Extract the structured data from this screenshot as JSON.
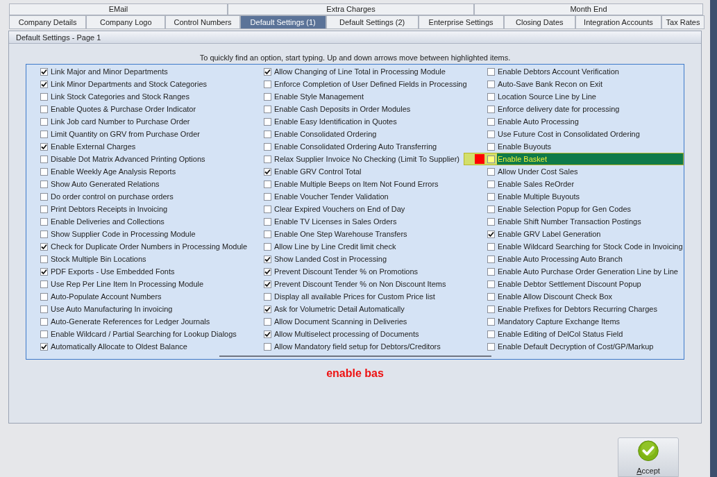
{
  "tabs_top": [
    {
      "label": "EMail",
      "selected": false
    },
    {
      "label": "Extra Charges",
      "selected": false
    },
    {
      "label": "Month End",
      "selected": false
    }
  ],
  "tabs": [
    {
      "label": "Company Details",
      "selected": false
    },
    {
      "label": "Company Logo",
      "selected": false
    },
    {
      "label": "Control Numbers",
      "selected": false
    },
    {
      "label": "Default Settings (1)",
      "selected": true
    },
    {
      "label": "Default Settings (2)",
      "selected": false
    },
    {
      "label": "Enterprise Settings",
      "selected": false
    },
    {
      "label": "Closing Dates",
      "selected": false
    },
    {
      "label": "Integration Accounts",
      "selected": false
    },
    {
      "label": "Tax Rates",
      "selected": false
    }
  ],
  "panel_title": "Default Settings - Page 1",
  "hint": "To quickly find an option, start typing. Up and down arrows move between highlighted items.",
  "columns": [
    [
      {
        "label": "Link Major and Minor Departments",
        "checked": true,
        "highlighted": false
      },
      {
        "label": "Link Minor Departments and Stock Categories",
        "checked": true,
        "highlighted": false
      },
      {
        "label": "Link Stock Categories and Stock Ranges",
        "checked": false,
        "highlighted": false
      },
      {
        "label": "Enable Quotes & Purchase Order Indicator",
        "checked": false,
        "highlighted": false
      },
      {
        "label": "Link Job card Number to Purchase Order",
        "checked": false,
        "highlighted": false
      },
      {
        "label": "Limit Quantity on GRV from Purchase Order",
        "checked": false,
        "highlighted": false
      },
      {
        "label": "Enable External Charges",
        "checked": true,
        "highlighted": false
      },
      {
        "label": "Disable Dot Matrix Advanced Printing Options",
        "checked": false,
        "highlighted": false
      },
      {
        "label": "Enable Weekly Age Analysis Reports",
        "checked": false,
        "highlighted": false
      },
      {
        "label": "Show Auto Generated Relations",
        "checked": false,
        "highlighted": false
      },
      {
        "label": "Do order control on purchase orders",
        "checked": false,
        "highlighted": false
      },
      {
        "label": "Print Debtors Receipts in Invoicing",
        "checked": false,
        "highlighted": false
      },
      {
        "label": "Enable Deliveries and Collections",
        "checked": false,
        "highlighted": false
      },
      {
        "label": "Show Supplier Code in Processing Module",
        "checked": false,
        "highlighted": false
      },
      {
        "label": "Check for Duplicate Order Numbers in Processing Module",
        "checked": true,
        "highlighted": false
      },
      {
        "label": "Stock Multiple Bin Locations",
        "checked": false,
        "highlighted": false
      },
      {
        "label": "PDF Exports - Use Embedded Fonts",
        "checked": true,
        "highlighted": false
      },
      {
        "label": "Use Rep Per Line Item In Processing Module",
        "checked": false,
        "highlighted": false
      },
      {
        "label": "Auto-Populate Account Numbers",
        "checked": false,
        "highlighted": false
      },
      {
        "label": "Use Auto Manufacturing In invoicing",
        "checked": false,
        "highlighted": false
      },
      {
        "label": "Auto-Generate References for Ledger Journals",
        "checked": false,
        "highlighted": false
      },
      {
        "label": "Enable Wildcard / Partial Searching for Lookup Dialogs",
        "checked": false,
        "highlighted": false
      },
      {
        "label": "Automatically Allocate to Oldest Balance",
        "checked": true,
        "highlighted": false
      }
    ],
    [
      {
        "label": "Allow Changing of Line Total in Processing Module",
        "checked": true,
        "highlighted": false
      },
      {
        "label": "Enforce Completion of User Defined Fields in Processing",
        "checked": false,
        "highlighted": false
      },
      {
        "label": "Enable Style Management",
        "checked": false,
        "highlighted": false
      },
      {
        "label": "Enable Cash Deposits in Order Modules",
        "checked": false,
        "highlighted": false
      },
      {
        "label": "Enable Easy Identification in Quotes",
        "checked": false,
        "highlighted": false
      },
      {
        "label": "Enable Consolidated Ordering",
        "checked": false,
        "highlighted": false
      },
      {
        "label": "Enable Consolidated Ordering Auto Transferring",
        "checked": false,
        "highlighted": false
      },
      {
        "label": "Relax Supplier Invoice No Checking (Limit To Supplier)",
        "checked": false,
        "highlighted": false
      },
      {
        "label": "Enable GRV Control Total",
        "checked": true,
        "highlighted": false
      },
      {
        "label": "Enable Multiple Beeps on Item Not Found Errors",
        "checked": false,
        "highlighted": false
      },
      {
        "label": "Enable Voucher Tender Validation",
        "checked": false,
        "highlighted": false
      },
      {
        "label": "Clear Expired Vouchers on End of Day",
        "checked": false,
        "highlighted": false
      },
      {
        "label": "Enable TV Licenses in Sales Orders",
        "checked": false,
        "highlighted": false
      },
      {
        "label": "Enable One Step Warehouse Transfers",
        "checked": false,
        "highlighted": false
      },
      {
        "label": "Allow Line by Line Credit limit check",
        "checked": false,
        "highlighted": false
      },
      {
        "label": "Show Landed Cost in Processing",
        "checked": true,
        "highlighted": false
      },
      {
        "label": "Prevent Discount Tender % on Promotions",
        "checked": true,
        "highlighted": false
      },
      {
        "label": "Prevent Discount Tender % on Non Discount Items",
        "checked": true,
        "highlighted": false
      },
      {
        "label": "Display all available Prices for Custom Price list",
        "checked": false,
        "highlighted": false
      },
      {
        "label": "Ask for Volumetric Detail Automatically",
        "checked": true,
        "highlighted": false
      },
      {
        "label": "Allow Document Scanning in Deliveries",
        "checked": false,
        "highlighted": false
      },
      {
        "label": "Allow Multiselect processing of Documents",
        "checked": true,
        "highlighted": false
      },
      {
        "label": "Allow Mandatory field setup for Debtors/Creditors",
        "checked": false,
        "highlighted": false
      }
    ],
    [
      {
        "label": "Enable Debtors Account Verification",
        "checked": false,
        "highlighted": false
      },
      {
        "label": "Auto-Save Bank Recon on Exit",
        "checked": false,
        "highlighted": false
      },
      {
        "label": "Location Source Line by Line",
        "checked": false,
        "highlighted": false
      },
      {
        "label": "Enforce delivery date for processing",
        "checked": false,
        "highlighted": false
      },
      {
        "label": "Enable Auto Processing",
        "checked": false,
        "highlighted": false
      },
      {
        "label": "Use Future Cost in Consolidated Ordering",
        "checked": false,
        "highlighted": false
      },
      {
        "label": "Enable Buyouts",
        "checked": false,
        "highlighted": false
      },
      {
        "label": "Enable Basket",
        "checked": false,
        "highlighted": true
      },
      {
        "label": "Allow Under Cost Sales",
        "checked": false,
        "highlighted": false
      },
      {
        "label": "Enable Sales ReOrder",
        "checked": false,
        "highlighted": false
      },
      {
        "label": "Enable Multiple Buyouts",
        "checked": false,
        "highlighted": false
      },
      {
        "label": "Enable Selection Popup for Gen Codes",
        "checked": false,
        "highlighted": false
      },
      {
        "label": "Enable Shift Number Transaction Postings",
        "checked": false,
        "highlighted": false
      },
      {
        "label": "Enable GRV Label Generation",
        "checked": true,
        "highlighted": false
      },
      {
        "label": "Enable Wildcard Searching for Stock Code in Invoicing",
        "checked": false,
        "highlighted": false
      },
      {
        "label": "Enable Auto Processing Auto Branch",
        "checked": false,
        "highlighted": false
      },
      {
        "label": "Enable Auto Purchase Order Generation Line by Line",
        "checked": false,
        "highlighted": false
      },
      {
        "label": "Enable Debtor Settlement Discount Popup",
        "checked": false,
        "highlighted": false
      },
      {
        "label": "Enable Allow Discount Check Box",
        "checked": false,
        "highlighted": false
      },
      {
        "label": "Enable Prefixes for Debtors Recurring Charges",
        "checked": false,
        "highlighted": false
      },
      {
        "label": "Mandatory Capture Exchange Items",
        "checked": false,
        "highlighted": false
      },
      {
        "label": "Enable Editing of DelCol Status Field",
        "checked": false,
        "highlighted": false
      },
      {
        "label": "Enable Default Decryption of Cost/GP/Markup",
        "checked": false,
        "highlighted": false
      }
    ]
  ],
  "search_text": "enable bas",
  "accept_button": "Accept"
}
